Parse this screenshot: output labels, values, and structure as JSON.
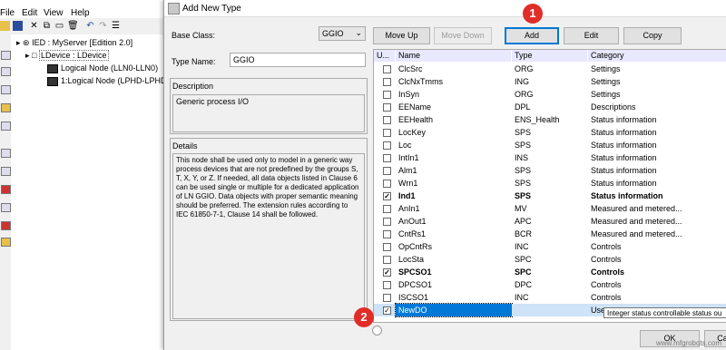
{
  "menubar": {
    "items": [
      "File",
      "Edit",
      "View",
      "Help"
    ]
  },
  "tree": {
    "ied": "IED : MyServer [Edition 2.0]",
    "ldevice": "LDevice : LDevice",
    "ln0": "Logical Node (LLN0-LLN0)",
    "ln1": "1:Logical Node (LPHD-LPHD"
  },
  "dialog": {
    "title": "Add New Type",
    "base_class_label": "Base Class:",
    "base_class_value": "GGIO",
    "type_name_label": "Type Name:",
    "type_name_value": "GGIO",
    "description_label": "Description",
    "description_text": "Generic process I/O",
    "details_label": "Details",
    "details_text": "This node shall be used only to model in a generic way process devices that are not predefined by the groups S, T, X, Y, or Z. If needed, all data objects listed in Clause 6 can be used single or multiple for a dedicated application of LN GGIO. Data objects with proper semantic meaning should be preferred. The extension rules according to IEC 61850-7-1, Clause 14 shall be followed.",
    "buttons": {
      "move_up": "Move Up",
      "move_down": "Move Down",
      "add": "Add",
      "edit": "Edit",
      "copy": "Copy",
      "ok": "OK",
      "cancel": "Ca"
    },
    "grid": {
      "headers": [
        "U...",
        "Name",
        "Type",
        "Category"
      ],
      "rows": [
        {
          "checked": false,
          "name": "ClcSrc",
          "type": "ORG",
          "category": "Settings"
        },
        {
          "checked": false,
          "name": "ClcNxTmms",
          "type": "ING",
          "category": "Settings"
        },
        {
          "checked": false,
          "name": "InSyn",
          "type": "ORG",
          "category": "Settings"
        },
        {
          "checked": false,
          "name": "EEName",
          "type": "DPL",
          "category": "Descriptions"
        },
        {
          "checked": false,
          "name": "EEHealth",
          "type": "ENS_Health",
          "category": "Status information"
        },
        {
          "checked": false,
          "name": "LocKey",
          "type": "SPS",
          "category": "Status information"
        },
        {
          "checked": false,
          "name": "Loc",
          "type": "SPS",
          "category": "Status information"
        },
        {
          "checked": false,
          "name": "IntIn1",
          "type": "INS",
          "category": "Status information"
        },
        {
          "checked": false,
          "name": "Alm1",
          "type": "SPS",
          "category": "Status information"
        },
        {
          "checked": false,
          "name": "Wrn1",
          "type": "SPS",
          "category": "Status information"
        },
        {
          "checked": true,
          "name": "Ind1",
          "type": "SPS",
          "category": "Status information",
          "bold": true
        },
        {
          "checked": false,
          "name": "AnIn1",
          "type": "MV",
          "category": "Measured and metered..."
        },
        {
          "checked": false,
          "name": "AnOut1",
          "type": "APC",
          "category": "Measured and metered..."
        },
        {
          "checked": false,
          "name": "CntRs1",
          "type": "BCR",
          "category": "Measured and metered..."
        },
        {
          "checked": false,
          "name": "OpCntRs",
          "type": "INC",
          "category": "Controls"
        },
        {
          "checked": false,
          "name": "LocSta",
          "type": "SPC",
          "category": "Controls"
        },
        {
          "checked": true,
          "name": "SPCSO1",
          "type": "SPC",
          "category": "Controls",
          "bold": true
        },
        {
          "checked": false,
          "name": "DPCSO1",
          "type": "DPC",
          "category": "Controls"
        },
        {
          "checked": false,
          "name": "ISCSO1",
          "type": "INC",
          "category": "Controls"
        },
        {
          "checked": true,
          "name": "NewDO",
          "type": "",
          "category": "User",
          "selected": true
        }
      ]
    },
    "tooltip": "Integer status controllable status ou"
  },
  "callouts": {
    "one": "1",
    "two": "2"
  },
  "watermark": "www.mfgrobots.com",
  "colors": {
    "callout": "#e02d28",
    "selection": "#0078d7",
    "header": "#e8e8ff"
  }
}
